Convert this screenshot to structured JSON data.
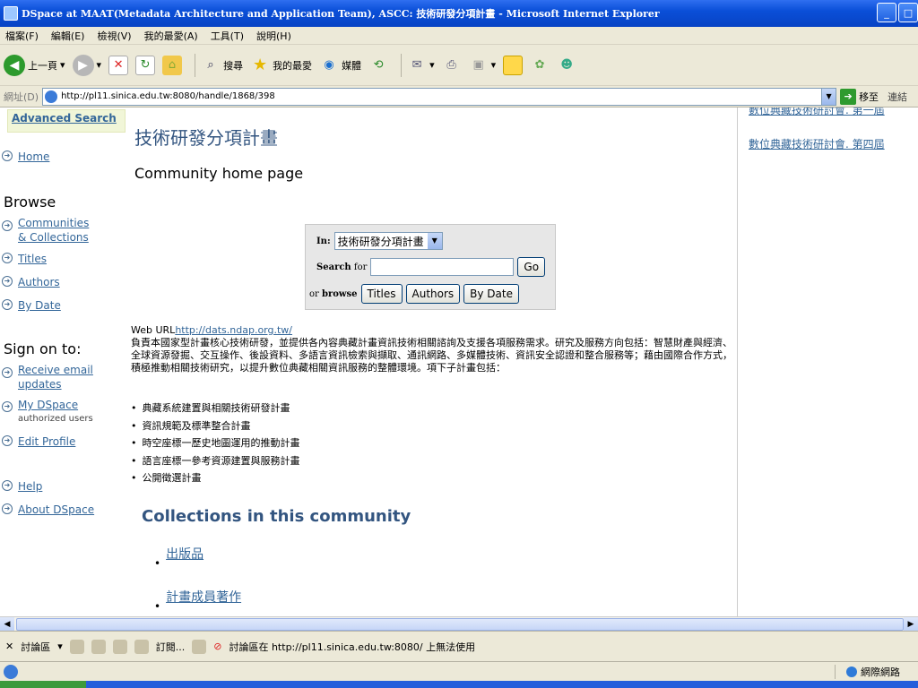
{
  "window": {
    "title": "DSpace at MAAT(Metadata Architecture and Application Team), ASCC: 技術研發分項計畫 - Microsoft Internet Explorer"
  },
  "menu": [
    "檔案(F)",
    "編輯(E)",
    "檢視(V)",
    "我的最愛(A)",
    "工具(T)",
    "說明(H)"
  ],
  "toolbar": {
    "back_label": "上一頁",
    "search_label": "搜尋",
    "favorites_label": "我的最愛",
    "media_label": "媒體"
  },
  "address": {
    "label": "網址(D)",
    "url": "http://pl11.sinica.edu.tw:8080/handle/1868/398",
    "go_label": "移至",
    "links_label": "連結"
  },
  "sidebar": {
    "advanced_search": "Advanced Search",
    "home": "Home",
    "browse_heading": "Browse",
    "communities": "Communities",
    "collections": "& Collections",
    "titles": "Titles",
    "authors": "Authors",
    "by_date": "By Date",
    "sign_on_heading": "Sign on to:",
    "receive_email": "Receive email",
    "updates": "updates",
    "my_dspace": "My DSpace",
    "authorized_users": "authorized users",
    "edit_profile": "Edit Profile",
    "help": "Help",
    "about": "About DSpace"
  },
  "main": {
    "title": "技術研發分項計畫",
    "subtitle": "Community home page",
    "search": {
      "in_label": "In:",
      "scope_value": "技術研發分項計畫",
      "search_label": "Search",
      "for_label": "for",
      "go_label": "Go",
      "or_label": "or",
      "browse_label": "browse",
      "titles_btn": "Titles",
      "authors_btn": "Authors",
      "by_date_btn": "By Date"
    },
    "web_url_label": "Web URL",
    "web_url": "http://dats.ndap.org.tw/",
    "description": "負責本國家型計畫核心技術研發，並提供各內容典藏計畫資訊技術相關諮詢及支援各項服務需求。研究及服務方向包括：智慧財產與經濟、全球資源發掘、交互操作、後設資料、多語言資訊檢索與擷取、通訊網路、多媒體技術、資訊安全認證和整合服務等；藉由國際合作方式，積極推動相關技術研究，以提升數位典藏相關資訊服務的整體環境。項下子計畫包括：",
    "bullets": [
      "典藏系統建置與相關技術研發計畫",
      "資訊規範及標準整合計畫",
      "時空座標一歷史地圖運用的推動計畫",
      "語言座標一參考資源建置與服務計畫",
      "公開徵選計畫"
    ],
    "collections_heading": "Collections in this community",
    "collections": [
      "出版品",
      "計畫成員著作"
    ]
  },
  "right": {
    "link_partial": "數位典藏技術研討會. 第一屆",
    "link_4th": "數位典藏技術研討會. 第四屆"
  },
  "discussion": {
    "label": "討論區",
    "subscribe": "訂閱...",
    "message": "討論區在 http://pl11.sinica.edu.tw:8080/ 上無法使用"
  },
  "status": {
    "zone": "網際網路"
  }
}
